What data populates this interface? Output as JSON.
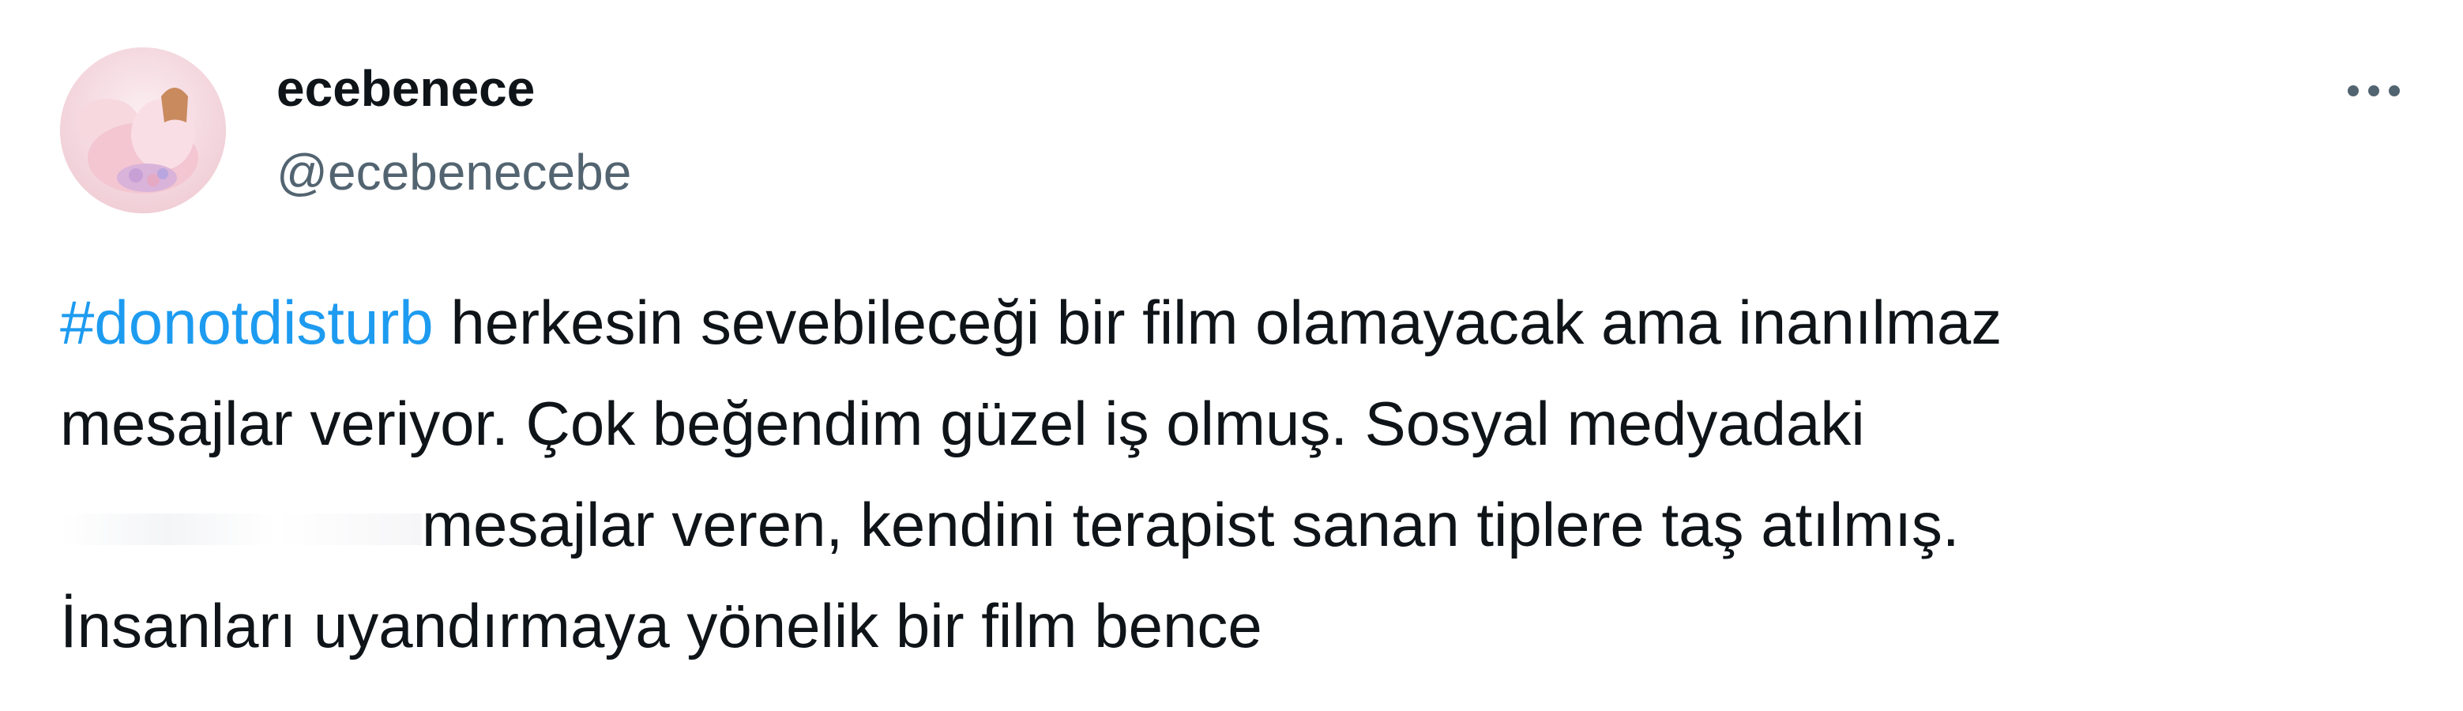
{
  "tweet": {
    "author": {
      "display_name": "ecebenece",
      "handle": "@ecebenecebe"
    },
    "more_icon": "more-horizontal-icon",
    "text": {
      "hashtag": "#donotdisturb",
      "line1_rest": " herkesin sevebileceği bir film olamayacak ama inanılmaz",
      "line2": "mesajlar veriyor. Çok beğendim güzel iş olmuş. Sosyal medyadaki",
      "line3_rest": "mesajlar veren, kendini terapist sanan tiplere taş atılmış.",
      "line4": "İnsanları uyandırmaya yönelik bir film bence"
    },
    "colors": {
      "text": "#0f1419",
      "secondary": "#536471",
      "link": "#1d9bf0"
    }
  }
}
